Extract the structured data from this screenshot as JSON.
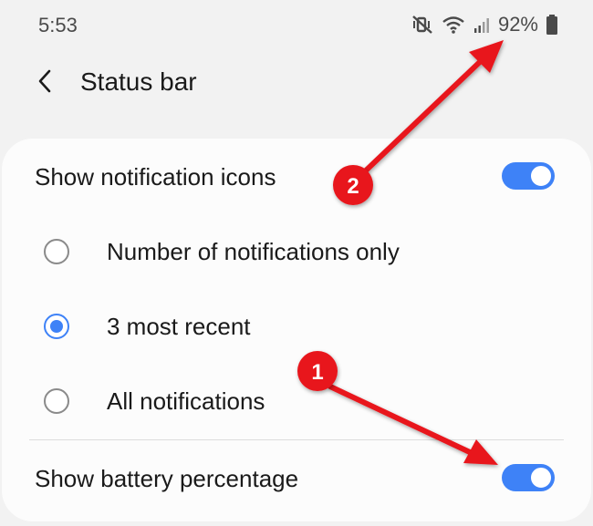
{
  "status_bar": {
    "time": "5:53",
    "battery_percent": "92%",
    "icons": [
      "mute-vibrate-icon",
      "wifi-icon",
      "signal-icon",
      "battery-icon"
    ]
  },
  "header": {
    "back_icon": "chevron-left-icon",
    "title": "Status bar"
  },
  "settings": {
    "show_notification_icons": {
      "label": "Show notification icons",
      "enabled": true
    },
    "notification_options": [
      {
        "label": "Number of notifications only",
        "selected": false
      },
      {
        "label": "3 most recent",
        "selected": true
      },
      {
        "label": "All notifications",
        "selected": false
      }
    ],
    "show_battery_percentage": {
      "label": "Show battery percentage",
      "enabled": true
    }
  },
  "annotations": [
    {
      "number": "1"
    },
    {
      "number": "2"
    }
  ],
  "colors": {
    "accent": "#3e82f7",
    "annotation": "#e8141c",
    "background": "#f2f2f2",
    "card": "#fcfcfc"
  }
}
